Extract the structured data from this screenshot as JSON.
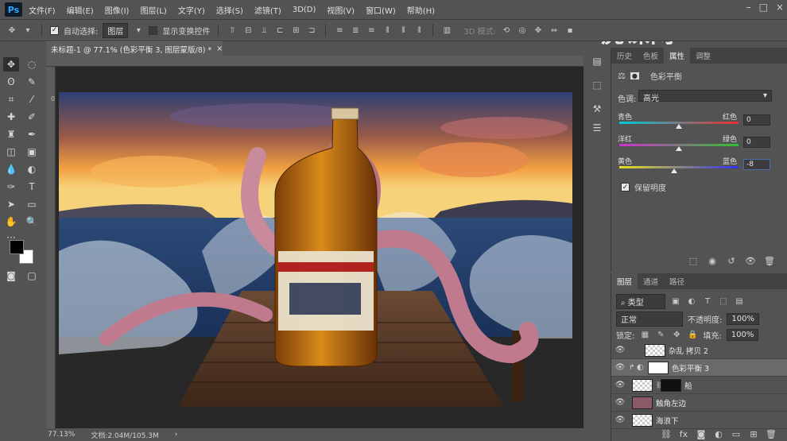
{
  "app": {
    "logo": "Ps"
  },
  "menu": [
    "文件(F)",
    "编辑(E)",
    "图像(I)",
    "图层(L)",
    "文字(Y)",
    "选择(S)",
    "滤镜(T)",
    "3D(D)",
    "视图(V)",
    "窗口(W)",
    "帮助(H)"
  ],
  "options_bar": {
    "auto_select_label": "自动选择:",
    "auto_select_value": "图层",
    "show_transform_label": "显示变换控件",
    "mode_3d_label": "3D 模式:"
  },
  "document": {
    "tab_title": "未标题-1 @ 77.1% (色彩平衡 3, 图层蒙版/8) *",
    "ruler_zero": "0"
  },
  "status": {
    "zoom": "77.13%",
    "doc_size": "文档:2.04M/105.3M"
  },
  "properties": {
    "tabs": [
      "历史",
      "色板",
      "属性",
      "调整"
    ],
    "selected_tab": "属性",
    "panel_title": "色彩平衡",
    "tone_label": "色调:",
    "tone_value": "高光",
    "sliders": [
      {
        "left": "青色",
        "right": "红色",
        "value": "0",
        "position": 0.5
      },
      {
        "left": "洋红",
        "right": "绿色",
        "value": "0",
        "position": 0.5
      },
      {
        "left": "黄色",
        "right": "蓝色",
        "value": "-8",
        "position": 0.46
      }
    ],
    "preserve_luminosity": "保留明度"
  },
  "layers": {
    "tabs": [
      "图层",
      "通道",
      "路径"
    ],
    "kind_label": "类型",
    "blend_mode": "正常",
    "opacity_label": "不透明度:",
    "opacity_value": "100%",
    "lock_label": "锁定:",
    "fill_label": "填充:",
    "fill_value": "100%",
    "items": [
      {
        "name": "杂乱 拷贝 2",
        "selected": false
      },
      {
        "name": "色彩平衡 3",
        "selected": true
      },
      {
        "name": "船",
        "selected": false
      },
      {
        "name": "触角左边",
        "selected": false
      },
      {
        "name": "海浪下",
        "selected": false
      }
    ]
  },
  "watermark": "虎课网",
  "colors": {
    "foreground": "#000000",
    "background": "#ffffff",
    "ui_bg": "#535353"
  }
}
